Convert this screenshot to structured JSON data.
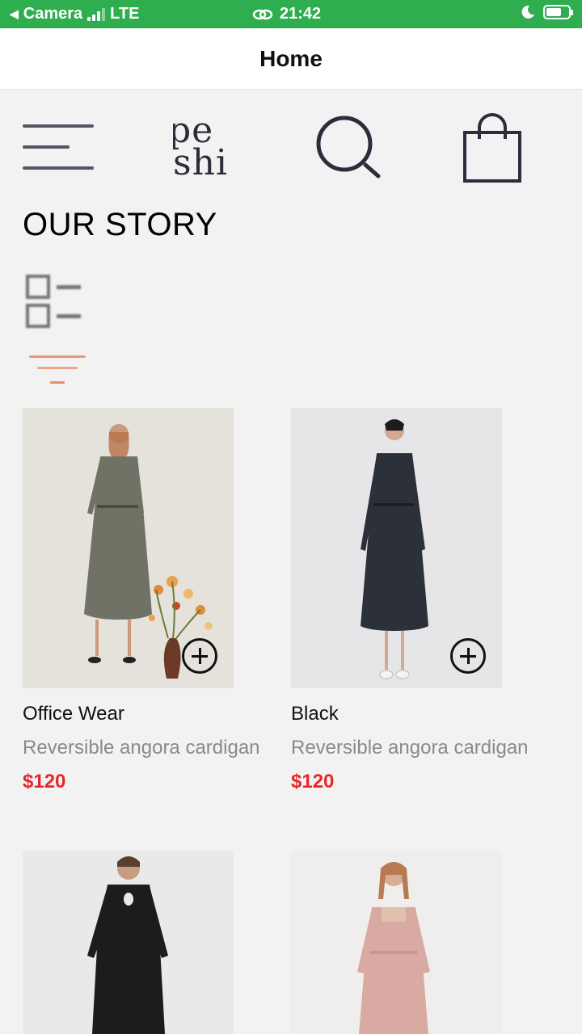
{
  "status_bar": {
    "back_app": "Camera",
    "network": "LTE",
    "time": "21:42",
    "battery_level": 0.7
  },
  "header": {
    "title": "Home"
  },
  "toolbar": {
    "menu_icon": "hamburger-menu-icon",
    "logo_line1": "pe",
    "logo_line2": "shi",
    "search_icon": "search-icon",
    "cart_icon": "shopping-bag-icon"
  },
  "section": {
    "title": "OUR STORY"
  },
  "controls": {
    "view_icon": "list-view-icon",
    "filter_icon": "filter-icon"
  },
  "colors": {
    "status_green": "#2fae4f",
    "price_red": "#e8262a",
    "filter_accent": "#e8704a"
  },
  "products": [
    {
      "name": "Office Wear",
      "description": "Reversible angora cardigan",
      "price": "$120",
      "dress_color": "#6f7264",
      "bg": "#e4e2da"
    },
    {
      "name": "Black",
      "description": "Reversible angora cardigan",
      "price": "$120",
      "dress_color": "#2c3038",
      "bg": "#e6e6e8"
    },
    {
      "name": "",
      "description": "",
      "price": "",
      "dress_color": "#1c1c1e",
      "bg": "#e9e9e9"
    },
    {
      "name": "",
      "description": "",
      "price": "",
      "dress_color": "#d8aaa2",
      "bg": "#f0eeec"
    }
  ]
}
